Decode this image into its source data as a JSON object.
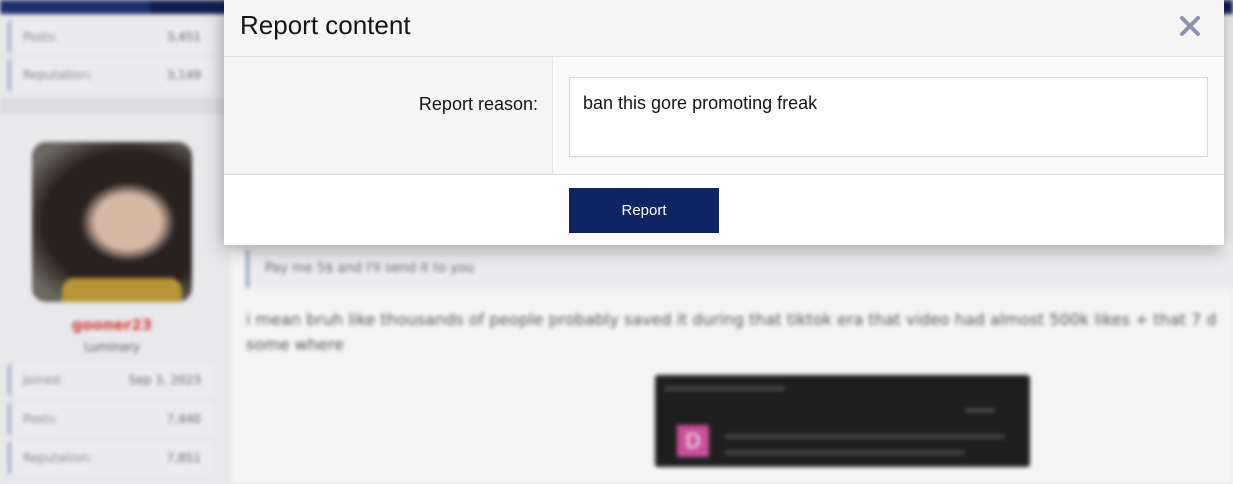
{
  "colors": {
    "brand_navy": "#0e2463",
    "username_red": "#d23a3a"
  },
  "background": {
    "top_stats": [
      {
        "label": "Posts:",
        "value": "3,451"
      },
      {
        "label": "Reputation:",
        "value": "3,149"
      }
    ],
    "user": {
      "name": "gooner23",
      "title": "Luminary",
      "stats": [
        {
          "label": "Joined:",
          "value": "Sep 3, 2023"
        },
        {
          "label": "Posts:",
          "value": "7,440"
        },
        {
          "label": "Reputation:",
          "value": "7,851"
        }
      ]
    },
    "post": {
      "quote": "Pay me 5$ and I'll send it to you",
      "text_line1": "i mean bruh like thousands of people probably saved it during that tiktok era that video had almost 500k likes + that 7 d",
      "text_line2": "some where",
      "embed_tile": "D"
    }
  },
  "modal": {
    "title": "Report content",
    "close_icon": "close-icon",
    "reason_label": "Report reason:",
    "reason_value": "ban this gore promoting freak",
    "report_button": "Report"
  }
}
